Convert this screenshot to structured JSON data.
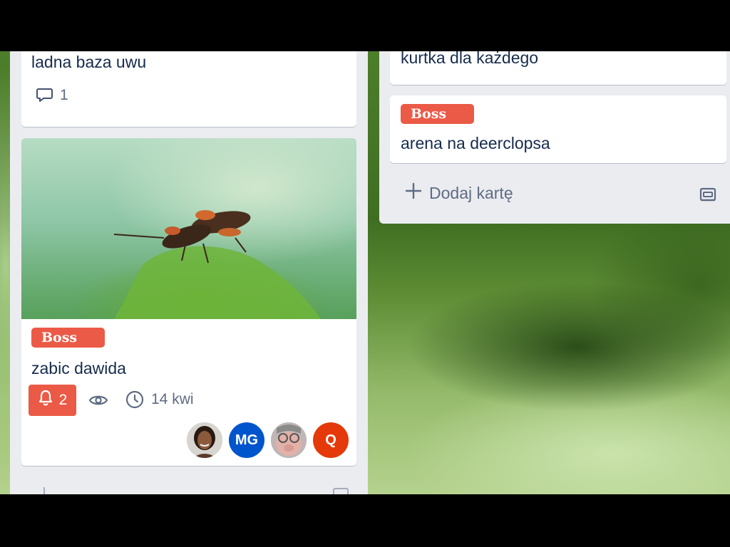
{
  "colors": {
    "label_red": "#eb5a46",
    "list_bg": "#ebecf0",
    "card_bg": "#ffffff",
    "text_muted": "#5e6c84",
    "avatar_blue": "#0055cc",
    "avatar_orange": "#e5390b"
  },
  "lists": [
    {
      "cards": [
        {
          "title": "ladna baza uwu",
          "badges": {
            "comments": "1",
            "comment_icon": "comment-icon"
          }
        },
        {
          "cover": "cover-image-beetles-on-leaf",
          "label": "Boss",
          "title": "zabic dawida",
          "badges": {
            "notifications": "2",
            "notification_icon": "bell-icon",
            "watch_icon": "eye-icon",
            "due_icon": "clock-icon",
            "due": "14 kwi"
          },
          "members": [
            {
              "initials": "",
              "kind": "photo",
              "name": "member-avatar-1"
            },
            {
              "initials": "MG",
              "kind": "initials"
            },
            {
              "initials": "",
              "kind": "photo",
              "name": "member-avatar-3"
            },
            {
              "initials": "Q",
              "kind": "initials"
            }
          ]
        }
      ]
    },
    {
      "cards": [
        {
          "title": "kurtka dla każdego"
        },
        {
          "label": "Boss",
          "title": "arena na deerclopsa"
        }
      ],
      "add_card": {
        "label": "Dodaj kartę",
        "icon": "plus-icon",
        "template_icon": "card-template-icon"
      }
    }
  ]
}
